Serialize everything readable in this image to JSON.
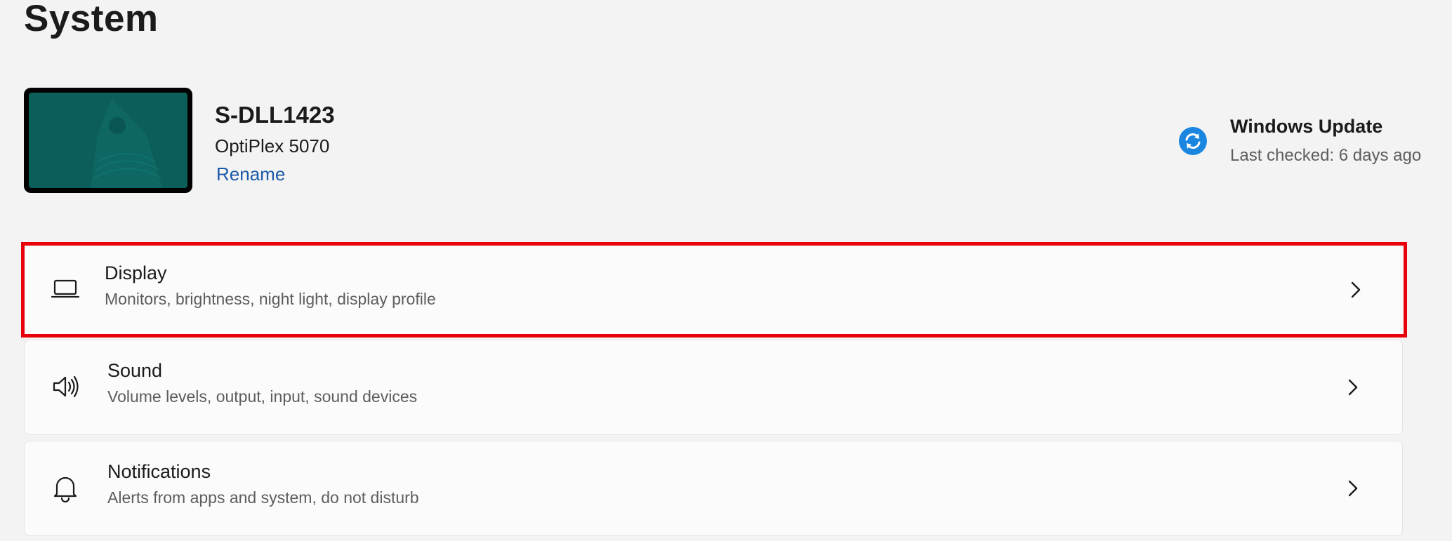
{
  "page": {
    "title": "System"
  },
  "device": {
    "name": "S-DLL1423",
    "model": "OptiPlex 5070",
    "rename_label": "Rename"
  },
  "windows_update": {
    "icon": "sync-icon",
    "title": "Windows Update",
    "status": "Last checked: 6 days ago"
  },
  "settings": [
    {
      "icon": "laptop-icon",
      "title": "Display",
      "description": "Monitors, brightness, night light, display profile",
      "highlighted": true
    },
    {
      "icon": "speaker-icon",
      "title": "Sound",
      "description": "Volume levels, output, input, sound devices",
      "highlighted": false
    },
    {
      "icon": "bell-icon",
      "title": "Notifications",
      "description": "Alerts from apps and system, do not disturb",
      "highlighted": false
    }
  ],
  "colors": {
    "accent_link": "#1d5aa8",
    "highlight_border": "#e8000b",
    "wallpaper": "#0b5e5a",
    "update_icon": "#1a86e0"
  }
}
